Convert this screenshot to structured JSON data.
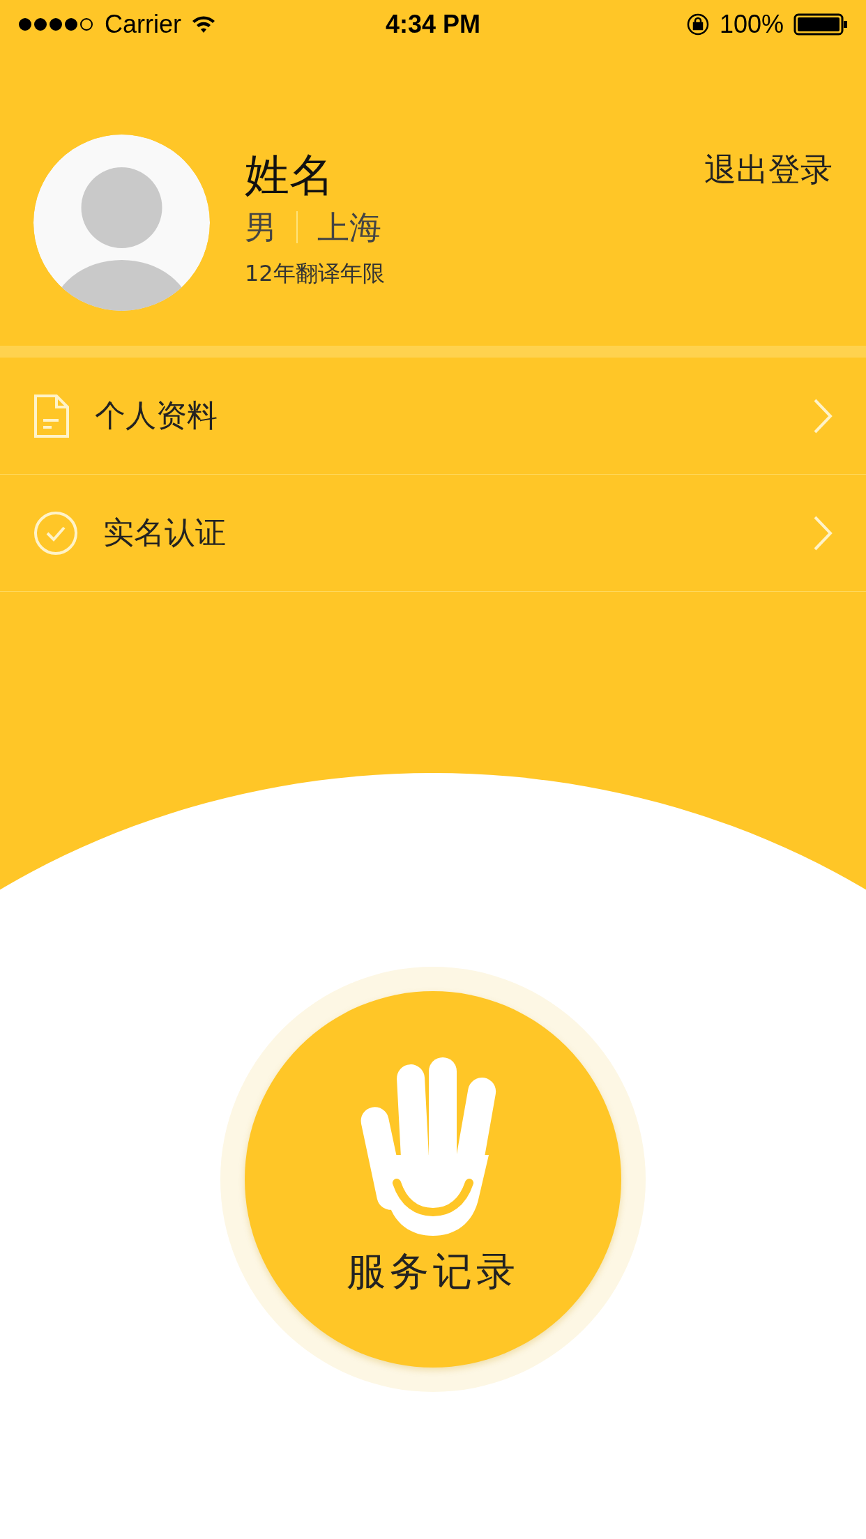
{
  "status_bar": {
    "carrier": "Carrier",
    "time": "4:34 PM",
    "battery": "100%"
  },
  "profile": {
    "name": "姓名",
    "gender": "男",
    "city": "上海",
    "experience": "12年翻译年限",
    "logout": "退出登录"
  },
  "menu": [
    {
      "kind": "document",
      "label": "个人资料"
    },
    {
      "kind": "verified",
      "label": "实名认证"
    }
  ],
  "action": {
    "label": "服务记录"
  }
}
